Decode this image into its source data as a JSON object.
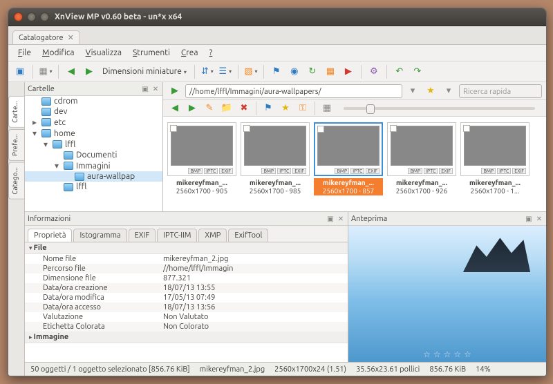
{
  "window": {
    "title": "XnView MP v0.60 beta - un*x x64"
  },
  "tab": {
    "label": "Catalogatore"
  },
  "menu": {
    "file": "File",
    "modifica": "Modifica",
    "visualizza": "Visualizza",
    "strumenti": "Strumenti",
    "crea": "Crea",
    "help": "?"
  },
  "toolbar": {
    "thumb_size_label": "Dimensioni miniature"
  },
  "side_tabs": {
    "cartelle": "Carte...",
    "preferiti": "Prefe...",
    "categorie": "Catego..."
  },
  "folders": {
    "title": "Cartelle",
    "items": [
      "cdrom",
      "dev",
      "etc",
      "home",
      "lffl",
      "Documenti",
      "Immagini",
      "aura-wallpap",
      "lffl"
    ]
  },
  "address": {
    "path": "//home/lffl/Immagini/aura-wallpapers/",
    "search_placeholder": "Ricerca rapida"
  },
  "thumbs": [
    {
      "name": "mikereyfman_...",
      "dims": "2560x1700 - 905",
      "img": "img-mountain",
      "selected": false
    },
    {
      "name": "mikereyfman_...",
      "dims": "2560x1700 - 985",
      "img": "img-lake",
      "selected": false
    },
    {
      "name": "mikereyfman_...",
      "dims": "2560x1700 - 857",
      "img": "img-ice",
      "selected": true
    },
    {
      "name": "mikereyfman_...",
      "dims": "2560x1700 - 926",
      "img": "img-santorini",
      "selected": false
    },
    {
      "name": "mikereyfman_...",
      "dims": "2560x1700 - 1...",
      "img": "img-crater",
      "selected": false
    }
  ],
  "info": {
    "title": "Informazioni",
    "tabs": [
      "Proprietà",
      "Istogramma",
      "EXIF",
      "IPTC-IIM",
      "XMP",
      "ExifTool"
    ],
    "group_file": "File",
    "group_image": "Immagine",
    "rows": [
      {
        "k": "Nome file",
        "v": "mikereyfman_2.jpg"
      },
      {
        "k": "Percorso file",
        "v": "//home/lffl/Immagin"
      },
      {
        "k": "Dimensione file",
        "v": "877.321"
      },
      {
        "k": "Data/ora creazione",
        "v": "18/07/13 13:55"
      },
      {
        "k": "Data/ora modifica",
        "v": "17/05/13 07:49"
      },
      {
        "k": "Data/ora accesso",
        "v": "18/07/13 13:56"
      },
      {
        "k": "Valutazione",
        "v": "Non Valutato"
      },
      {
        "k": "Etichetta Colorata",
        "v": "Non Colorato"
      }
    ]
  },
  "preview": {
    "title": "Anteprima"
  },
  "status": {
    "selection": "50 oggetti / 1 oggetto selezionato [856.76 KiB]",
    "filename": "mikereyfman_2.jpg",
    "dims": "2560x1700x24 (1.51)",
    "phys": "35.56x23.61 pollici",
    "size": "856.76 KiB",
    "zoom": "14%"
  }
}
